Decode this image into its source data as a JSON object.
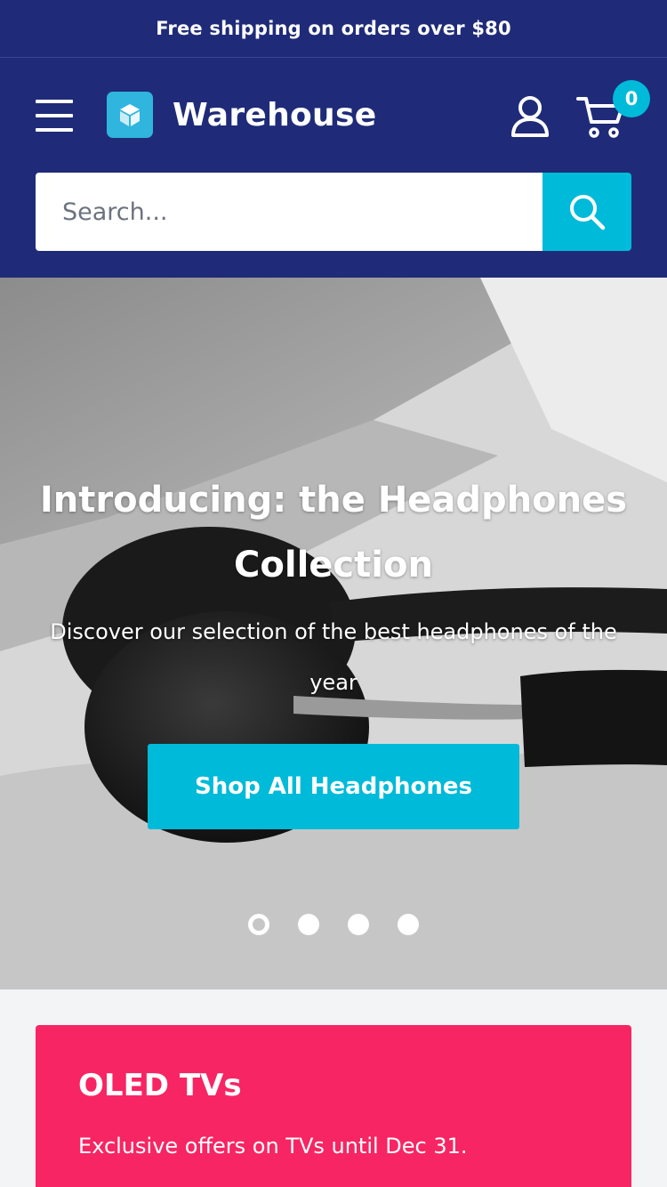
{
  "announcement": {
    "text": "Free shipping on orders over $80"
  },
  "header": {
    "menu_icon": "hamburger-menu-icon",
    "logo_icon": "box-logo-icon",
    "brand": "Warehouse",
    "account_icon": "user-icon",
    "cart_icon": "shopping-cart-icon",
    "cart_count": "0"
  },
  "search": {
    "placeholder": "Search...",
    "button_icon": "search-icon"
  },
  "hero": {
    "title": "Introducing: the Headphones Collection",
    "subtitle": "Discover our selection of the best headphones of the year",
    "button_label": "Shop All Headphones",
    "slides_total": 4,
    "active_slide": 1
  },
  "promo": {
    "title": "OLED TVs",
    "text": "Exclusive offers on TVs until Dec 31."
  },
  "colors": {
    "navy": "#1f2b78",
    "accent": "#00bad9",
    "promo": "#f72563"
  }
}
